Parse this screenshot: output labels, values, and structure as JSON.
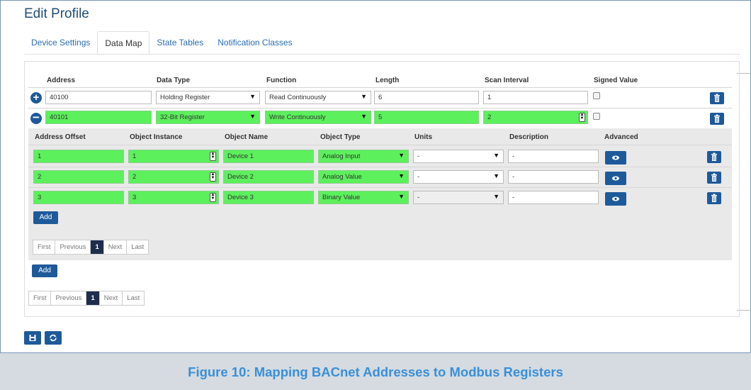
{
  "page_title": "Edit Profile",
  "tabs": [
    {
      "label": "Device Settings"
    },
    {
      "label": "Data Map"
    },
    {
      "label": "State Tables"
    },
    {
      "label": "Notification Classes"
    }
  ],
  "map_headers": {
    "address": "Address",
    "data_type": "Data Type",
    "function": "Function",
    "length": "Length",
    "scan_interval": "Scan Interval",
    "signed_value": "Signed Value"
  },
  "map_rows": [
    {
      "address": "40100",
      "data_type": "Holding Register",
      "function": "Read Continuously",
      "length": "6",
      "scan_interval": "1",
      "expand_icon": "plus-circle-icon"
    },
    {
      "address": "40101",
      "data_type": "32-Bit Register",
      "function": "Write Continuously",
      "length": "5",
      "scan_interval": "2",
      "expand_icon": "minus-circle-icon"
    }
  ],
  "object_headers": {
    "address_offset": "Address Offset",
    "object_instance": "Object Instance",
    "object_name": "Object Name",
    "object_type": "Object Type",
    "units": "Units",
    "description": "Description",
    "advanced": "Advanced"
  },
  "object_rows": [
    {
      "address_offset": "1",
      "object_instance": "1",
      "object_name": "Device 1",
      "object_type": "Analog Input",
      "units": "-",
      "description": "-"
    },
    {
      "address_offset": "2",
      "object_instance": "2",
      "object_name": "Device 2",
      "object_type": "Analog Value",
      "units": "-",
      "description": "-"
    },
    {
      "address_offset": "3",
      "object_instance": "3",
      "object_name": "Device 3",
      "object_type": "Binary Value",
      "units": "-",
      "description": "-"
    }
  ],
  "add_label": "Add",
  "pager": {
    "first": "First",
    "previous": "Previous",
    "current": "1",
    "next": "Next",
    "last": "Last"
  },
  "caption": "Figure 10: Mapping BACnet Addresses to Modbus Registers",
  "colors": {
    "accent": "#1e5a9a",
    "highlight": "#5cf05c",
    "caption_text": "#3a8fd8"
  }
}
